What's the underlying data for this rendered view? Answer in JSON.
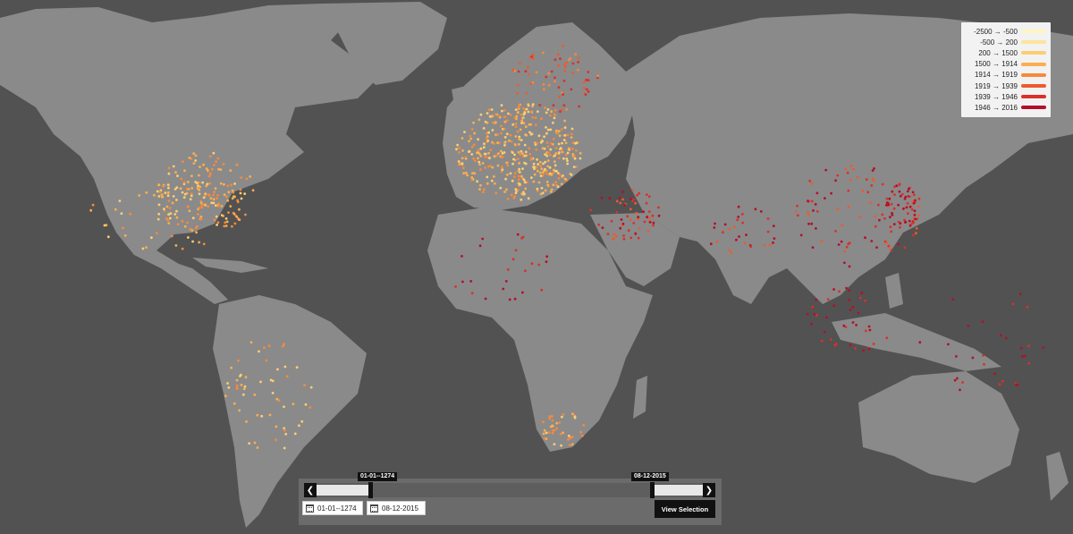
{
  "map": {
    "background": "#525252",
    "land_color": "#8a8a8a"
  },
  "legend": {
    "items": [
      {
        "label": "-2500 → -500",
        "color": "#fff5c2"
      },
      {
        "label": "-500 → 200",
        "color": "#fde49b"
      },
      {
        "label": "200 → 1500",
        "color": "#fcce73"
      },
      {
        "label": "1500 → 1914",
        "color": "#fbae51"
      },
      {
        "label": "1914 → 1919",
        "color": "#f58a3c"
      },
      {
        "label": "1919 → 1939",
        "color": "#ec5b2d"
      },
      {
        "label": "1939 → 1946",
        "color": "#d9312a"
      },
      {
        "label": "1946 → 2016",
        "color": "#b3102a"
      }
    ]
  },
  "timeline": {
    "start_tip": "01-01--1274",
    "end_tip": "08-12-2015",
    "start_date": "01-01--1274",
    "end_date": "08-12-2015",
    "view_button": "View Selection",
    "prev_icon": "chevron-left-icon",
    "next_icon": "chevron-right-icon",
    "calendar_icon": "calendar-icon"
  }
}
